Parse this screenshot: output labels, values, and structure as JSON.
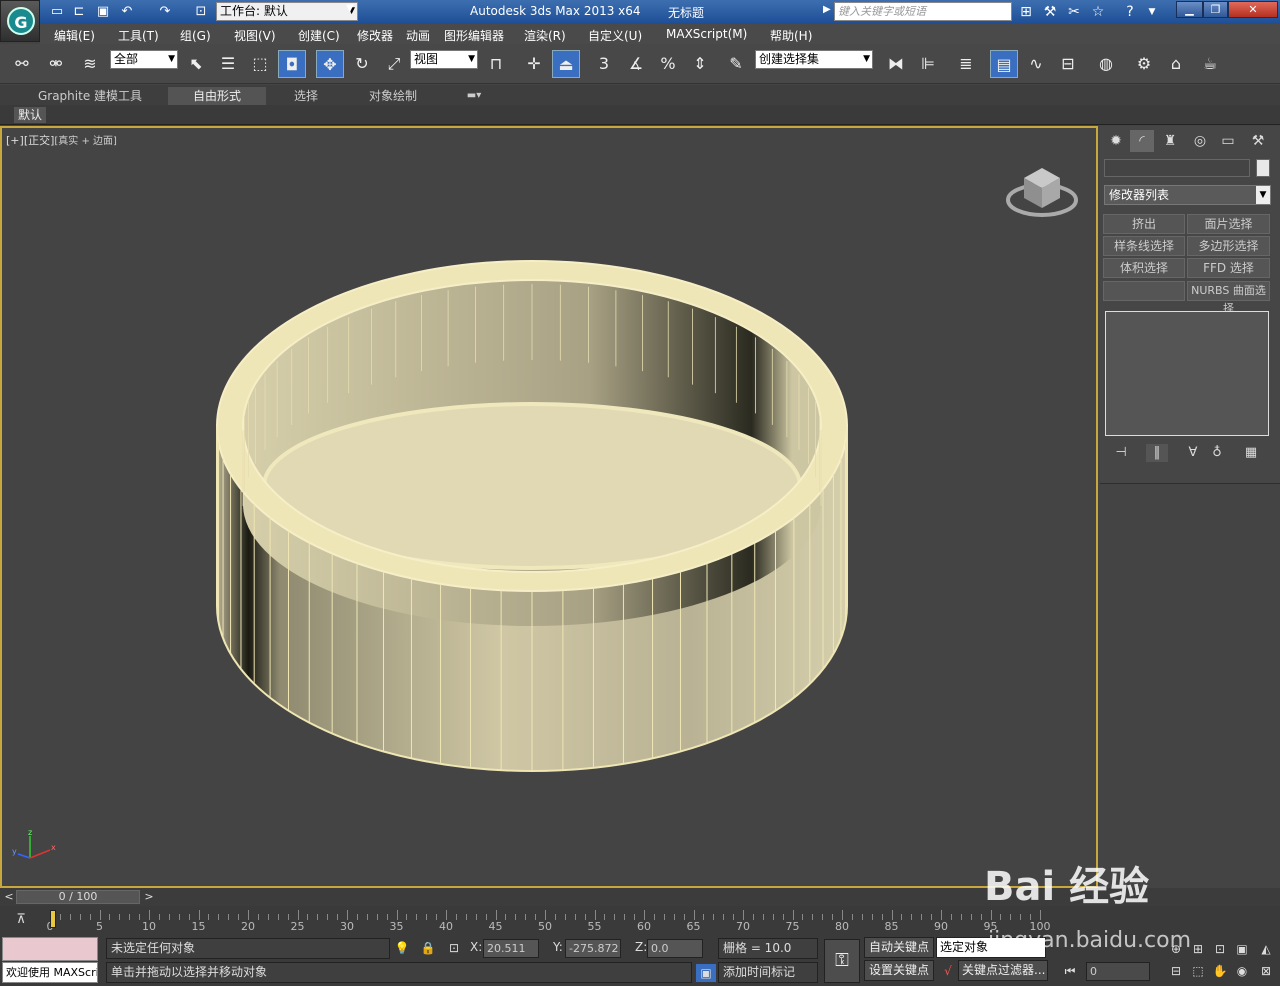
{
  "title_bar": {
    "app_title": "Autodesk 3ds Max  2013 x64",
    "doc_title": "无标题",
    "workspace": "工作台: 默认",
    "search_placeholder": "键入关键字或短语"
  },
  "menu": [
    "编辑(E)",
    "工具(T)",
    "组(G)",
    "视图(V)",
    "创建(C)",
    "修改器",
    "动画",
    "图形编辑器",
    "渲染(R)",
    "自定义(U)",
    "MAXScript(M)",
    "帮助(H)"
  ],
  "toolbar": {
    "filter_value": "全部",
    "refcoord_value": "视图",
    "selset_value": "创建选择集",
    "snap_num": "3",
    "angle_label": "%"
  },
  "ribbon": {
    "tabs": [
      "Graphite 建模工具",
      "自由形式",
      "选择",
      "对象绘制"
    ],
    "active_tab": "自由形式",
    "sub_button": "默认"
  },
  "viewport": {
    "label_a": "[+]",
    "label_b": "[正交]",
    "label_c": "[真实 + 边面]"
  },
  "command_panel": {
    "modifier_list": "修改器列表",
    "buttons": [
      "挤出",
      "面片选择",
      "样条线选择",
      "多边形选择",
      "体积选择",
      "FFD 选择",
      "",
      "NURBS 曲面选择"
    ]
  },
  "timeline": {
    "frame_display": "0 / 100",
    "ticks": [
      "0",
      "5",
      "10",
      "15",
      "20",
      "25",
      "30",
      "35",
      "40",
      "45",
      "50",
      "55",
      "60",
      "65",
      "70",
      "75",
      "80",
      "85",
      "90",
      "95",
      "100"
    ]
  },
  "status": {
    "welcome": "欢迎使用 MAXScri",
    "selection": "未选定任何对象",
    "prompt": "单击并拖动以选择并移动对象",
    "x_label": "X:",
    "x_value": "20.511",
    "y_label": "Y:",
    "y_value": "-275.872",
    "z_label": "Z:",
    "z_value": "0.0",
    "grid": "栅格 = 10.0",
    "add_time_tag": "添加时间标记",
    "auto_key": "自动关键点",
    "set_key": "设置关键点",
    "selected_object": "选定对象",
    "key_filters": "关键点过滤器...",
    "frame_value": "0"
  },
  "watermark": {
    "brand": "Bai 经验",
    "url": "jingyan.baidu.com"
  },
  "colors": {
    "viewport_border": "#c8a83c",
    "object_color": "#d8d0a8",
    "title_blue": "#2d5ea6"
  }
}
